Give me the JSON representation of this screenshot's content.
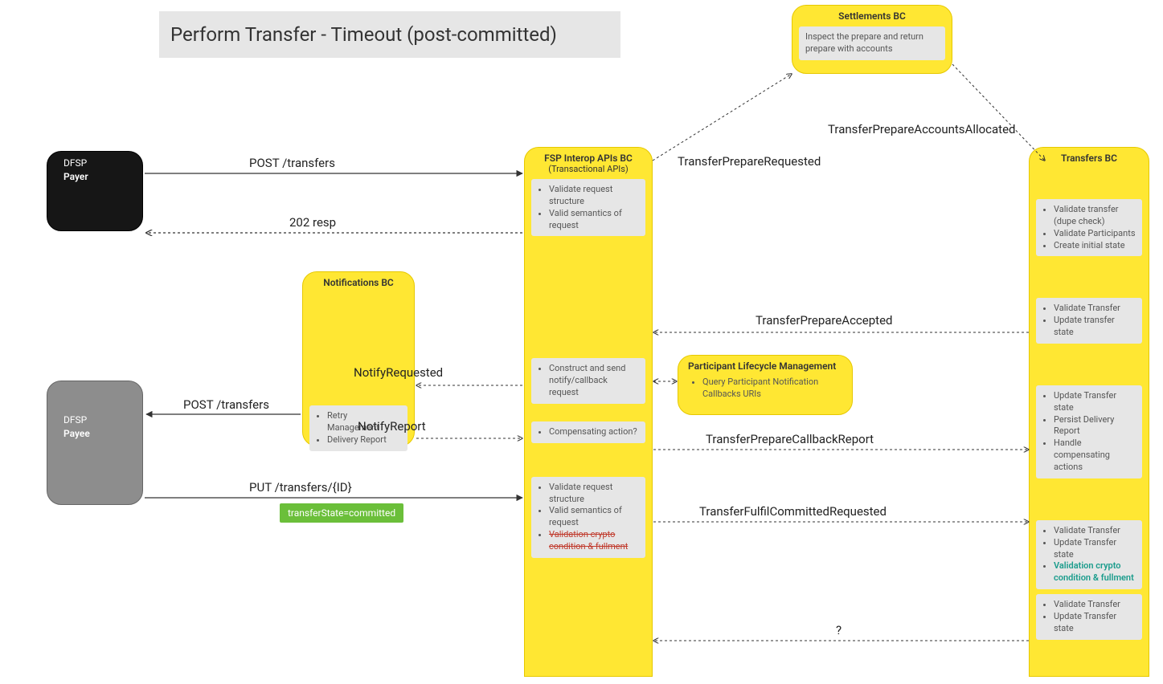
{
  "title": "Perform Transfer - Timeout (post-committed)",
  "actors": {
    "payer_line1": "DFSP",
    "payer_line2": "Payer",
    "payee_line1": "DFSP",
    "payee_line2": "Payee",
    "settlements_hdr": "Settlements BC",
    "settlements_note": "Inspect the prepare and return prepare with accounts",
    "notifications_hdr": "Notifications BC",
    "notifications_note1": "Retry Management",
    "notifications_note2": "Delivery Report",
    "fsp_hdr": "FSP Interop APIs BC",
    "fsp_sub": "(Transactional APIs)",
    "plm_hdr": "Participant Lifecycle Management",
    "plm_note": "Query Participant Notification Callbacks URIs",
    "transfers_hdr": "Transfers BC"
  },
  "fsp_notes": {
    "a1": "Validate request structure",
    "a2": "Valid semantics of request",
    "b1": "Construct and send notify/callback request",
    "c1": "Compensating action?",
    "d1": "Validate request structure",
    "d2": "Valid semantics of request",
    "d3": "Validation crypto condition & fullment"
  },
  "transfers_notes": {
    "a1": "Validate transfer (dupe check)",
    "a2": "Validate Participants",
    "a3": "Create initial state",
    "b1": "Validate Transfer",
    "b2": "Update transfer state",
    "c1": "Update Transfer state",
    "c2": "Persist Delivery Report",
    "c3": "Handle compensating actions",
    "d1": "Validate Transfer",
    "d2": "Update Transfer state",
    "d3": "Validation crypto condition & fullment",
    "e1": "Validate Transfer",
    "e2": "Update Transfer state"
  },
  "arrows": {
    "post_transfers": "POST /transfers",
    "resp_202": "202 resp",
    "transfer_prepare_requested": "TransferPrepareRequested",
    "transfer_prepare_accounts_allocated": "TransferPrepareAccountsAllocated",
    "transfer_prepare_accepted": "TransferPrepareAccepted",
    "notify_requested": "NotifyRequested",
    "notify_report": "NotifyReport",
    "post_transfers2": "POST /transfers",
    "transfer_prepare_callback_report": "TransferPrepareCallbackReport",
    "put_transfers_id": "PUT /transfers/{ID}",
    "transfer_fulfil_committed_requested": "TransferFulfilCommittedRequested",
    "question": "?"
  },
  "badges": {
    "transfer_state_committed": "transferState=committed"
  }
}
